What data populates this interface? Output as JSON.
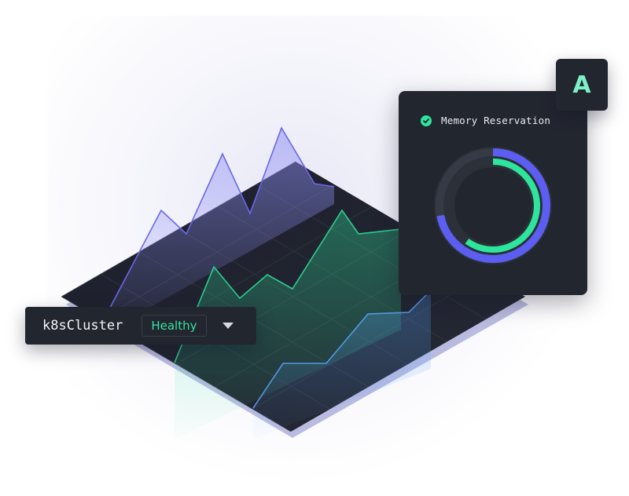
{
  "memory_card": {
    "title": "Memory Reservation",
    "status": "ok",
    "rings": {
      "outer_fraction": 0.72,
      "inner_fraction": 0.6,
      "colors": {
        "blue": "#5b5ef0",
        "green": "#2ee59d",
        "track": "#353a45"
      }
    }
  },
  "badge": {
    "label": "A"
  },
  "cluster": {
    "name": "k8sCluster",
    "status": "Healthy"
  },
  "colors": {
    "panel": "#22262f",
    "accent_green": "#2ee59d",
    "accent_blue": "#5b5ef0",
    "accent_lightblue": "#5aa8ff"
  }
}
